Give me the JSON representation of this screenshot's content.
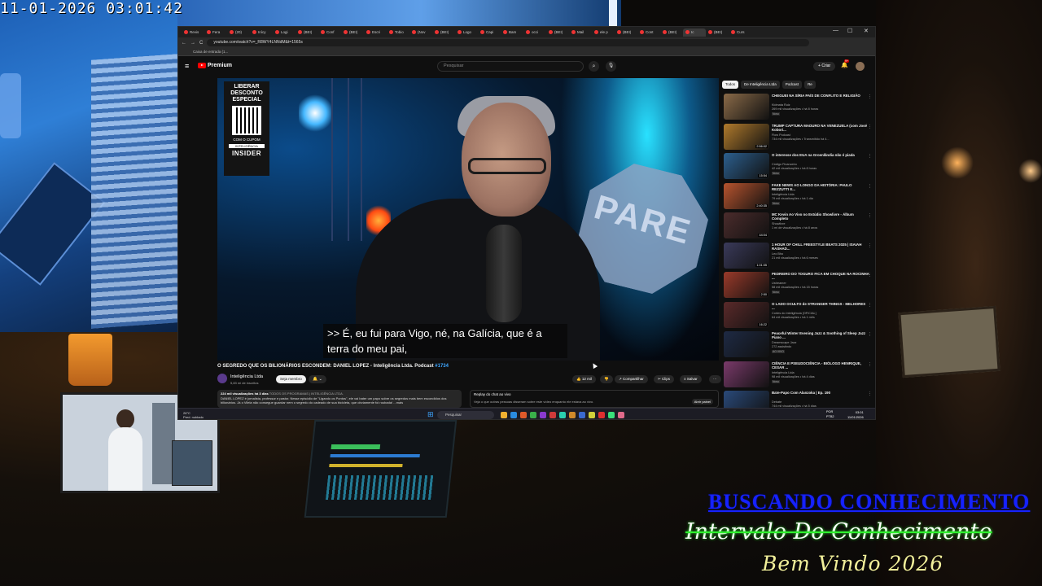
{
  "overlay": {
    "timestamp": "11-01-2026  03:01:42",
    "title_primary": "BUSCANDO CONHECIMENTO",
    "title_secondary": "Intervalo Do Conhecimento",
    "title_tertiary": "Bem Vindo 2026"
  },
  "browser": {
    "tabs": [
      "Revis",
      "Fera",
      "(20)",
      "Inícy",
      "Logi",
      "(BEI)",
      "Conf",
      "(BEI)",
      "Escri",
      "Tobio",
      "(Nov",
      "(BEI)",
      "Logo",
      "Capi",
      "Bam",
      "occi",
      "(BEI)",
      "Mail",
      "ele p",
      "(BEI)",
      "Cont",
      "(BEI)",
      "Ic",
      "(BEI)",
      "Curs"
    ],
    "active_tab_index": 22,
    "window_controls": {
      "minimize": "—",
      "maximize": "☐",
      "close": "✕"
    },
    "url": "youtube.com/watch?v=_R8WY4LNNdM&t=1565s",
    "bookmark": "Caixa de entrada (1...",
    "nav": {
      "back": "←",
      "forward": "→",
      "reload": "C"
    }
  },
  "youtube": {
    "logo_text": "Premium",
    "search_placeholder": "Pesquisar",
    "create_label": "Criar",
    "notifications_badge": "9+",
    "video": {
      "promo_lines": [
        "LIBERAR",
        "DESCONTO",
        "ESPECIAL"
      ],
      "promo_small": "COM O CUPOM",
      "promo_tag": "INTELIGÊNCIA",
      "promo_brand": "INSIDER",
      "stop_sign": "PARE",
      "caption": ">> É, eu fui para Vigo, né, na Galícia, que é a terra do meu pai,"
    },
    "title": "O SEGREDO QUE OS BILIONÁRIOS ESCONDEM: DANIEL LOPEZ - Inteligência Ltda. Podcast",
    "title_tag": "#1734",
    "channel": {
      "name": "Inteligência Ltda",
      "subs": "5,83 mi de inscritos",
      "join": "Seja membro"
    },
    "actions": {
      "likes": "12 mil",
      "share": "Compartilhar",
      "clips": "Clips",
      "save": "Salvar",
      "more": "···"
    },
    "description": {
      "meta": "224 mil visualizações  há 3 dias",
      "tags": "TODOS OS PROGRAMAS | INTELIGÊNCIA LTDA.",
      "text": "DANIEL LOPEZ é jornalista, professor e pastor. Nesse episódio de \"Ligando os Pontos\", ele vai bater um papo sobre os segredos mais bem escondidos dos bilionários. Já o Vilela não consegue guardar nem o segredo do cadeado de sua bicicleta, que obviamente foi roubada! ...mais"
    },
    "chat": {
      "title": "Replay do chat ao vivo",
      "sub": "Veja o que outras pessoas disseram sobre este vídeo enquanto ele estava ao vivo.",
      "open": "Abrir painel"
    },
    "chips": [
      "Todos",
      "De Inteligência Ltda",
      "Podcast",
      "Re"
    ],
    "recommendations": [
      {
        "title": "CHEGUEI NA SÍRIA PAÍS DE CONFLITO E RELIGIÃO",
        "channel": "Kidmata Ruiz",
        "meta": "269 mil visualizações • há 8 horas",
        "badge": "Novo",
        "duration": "",
        "color": "#8a6a48"
      },
      {
        "title": "TRUMP CAPTURA MADURO NA VENEZUELA (com José Kobori...",
        "channel": "Flow Podcast",
        "meta": "734 mil visualizações • Transmitido há 4...",
        "badge": "",
        "duration": "2:56:02",
        "color": "#b07a2c"
      },
      {
        "title": "O interesse dos EUA na Groenlândia não é piada",
        "channel": "Código Financeiro",
        "meta": "42 mil visualizações • há 8 horas",
        "badge": "Novo",
        "duration": "15:54",
        "color": "#2c5f8e"
      },
      {
        "title": "FAKE NEWS AO LONGO DA HISTÓRIA: PAULO REZZUTTI E...",
        "channel": "Inteligência Ltda",
        "meta": "79 mil visualizações • há 1 dia",
        "badge": "Novo",
        "duration": "2:40:35",
        "color": "#b8542e"
      },
      {
        "title": "MC Kevin Ao Vivo no Estúdio Showlivre - Álbum Completo",
        "channel": "Showlivre",
        "meta": "1 mi de visualizações • há 8 anos",
        "badge": "",
        "duration": "44:04",
        "color": "#4b2c2c"
      },
      {
        "title": "1 HOUR OF CHILL FREESTYLE BEATS 2025 | ISAIAH RASHAD...",
        "channel": "Leo Bho",
        "meta": "21 mil visualizações • há 6 meses",
        "badge": "",
        "duration": "1:01:05",
        "color": "#3a3a5a"
      },
      {
        "title": "PEDREIRO DO TOGURO FICA EM CHOQUE NA ROCINHA ...",
        "channel": "Ustreamer",
        "meta": "58 mil visualizações • há 15 horas",
        "badge": "Novo",
        "duration": "2:50",
        "color": "#9a3a2a"
      },
      {
        "title": "O LADO OCULTO de STRANGER THINGS - MELHORES ...",
        "channel": "Cortes do Inteligência [OFICIAL]",
        "meta": "64 mil visualizações • há 1 mês",
        "badge": "",
        "duration": "16:22",
        "color": "#5a2a2a"
      },
      {
        "title": "Peaceful Winter Evening Jazz & Soothing of Sleep Jazz Piano ...",
        "channel": "Dreamscape Jazz",
        "meta": "272 assistindo",
        "badge": "AO VIVO",
        "duration": "",
        "color": "#1e2a44"
      },
      {
        "title": "CIÊNCIA E PSEUDOCIÊNCIA - BIÓLOGO HENRIQUE, CESAR ...",
        "channel": "Inteligência Ltda",
        "meta": "98 mil visualizações • há 4 dias",
        "badge": "Novo",
        "duration": "",
        "color": "#7a3a6a"
      },
      {
        "title": "Bate-Papo Com Alanzoka | Ep. 190",
        "channel": "Debate",
        "meta": "744 mil visualizações • há 5 dias",
        "badge": "",
        "duration": "1:23:06",
        "color": "#2a4a7a"
      }
    ]
  },
  "taskbar": {
    "weather": [
      "26°C",
      "Pred. nublado"
    ],
    "search": "Pesquisar",
    "lang": [
      "POR",
      "PTB2"
    ],
    "time": "03:01",
    "date": "11/01/2026"
  }
}
